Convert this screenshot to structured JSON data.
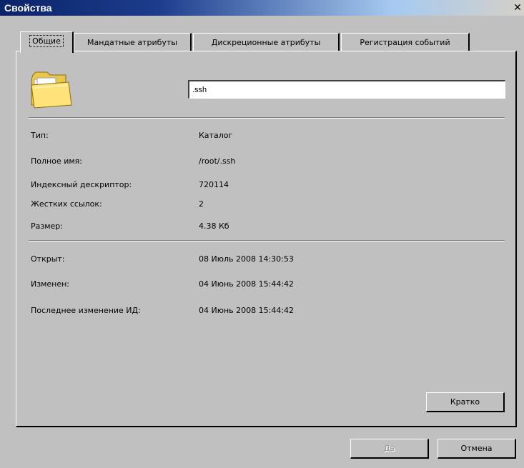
{
  "window": {
    "title": "Свойства",
    "close_icon": "close-icon"
  },
  "tabs": [
    {
      "label": "Общие",
      "active": true
    },
    {
      "label": "Мандатные атрибуты",
      "active": false
    },
    {
      "label": "Дискреционные атрибуты",
      "active": false
    },
    {
      "label": "Регистрация событий",
      "active": false
    }
  ],
  "general": {
    "icon": "folder-icon",
    "name_value": ".ssh",
    "properties": [
      {
        "label": "Тип:",
        "value": "Каталог"
      },
      {
        "label": "Полное имя:",
        "value": "/root/.ssh"
      },
      {
        "label": "Индексный дескриптор:",
        "value": "720114"
      },
      {
        "label": "Жестких ссылок:",
        "value": "2"
      },
      {
        "label": "Размер:",
        "value": "4.38 Кб"
      }
    ],
    "times": [
      {
        "label": "Открыт:",
        "value": "08 Июль 2008 14:30:53"
      },
      {
        "label": "Изменен:",
        "value": "04 Июнь 2008 15:44:42"
      },
      {
        "label": "Последнее изменение ИД:",
        "value": "04 Июнь 2008 15:44:42"
      }
    ],
    "brief_button": "Кратко"
  },
  "buttons": {
    "ok": "Да",
    "ok_disabled": true,
    "cancel": "Отмена"
  }
}
